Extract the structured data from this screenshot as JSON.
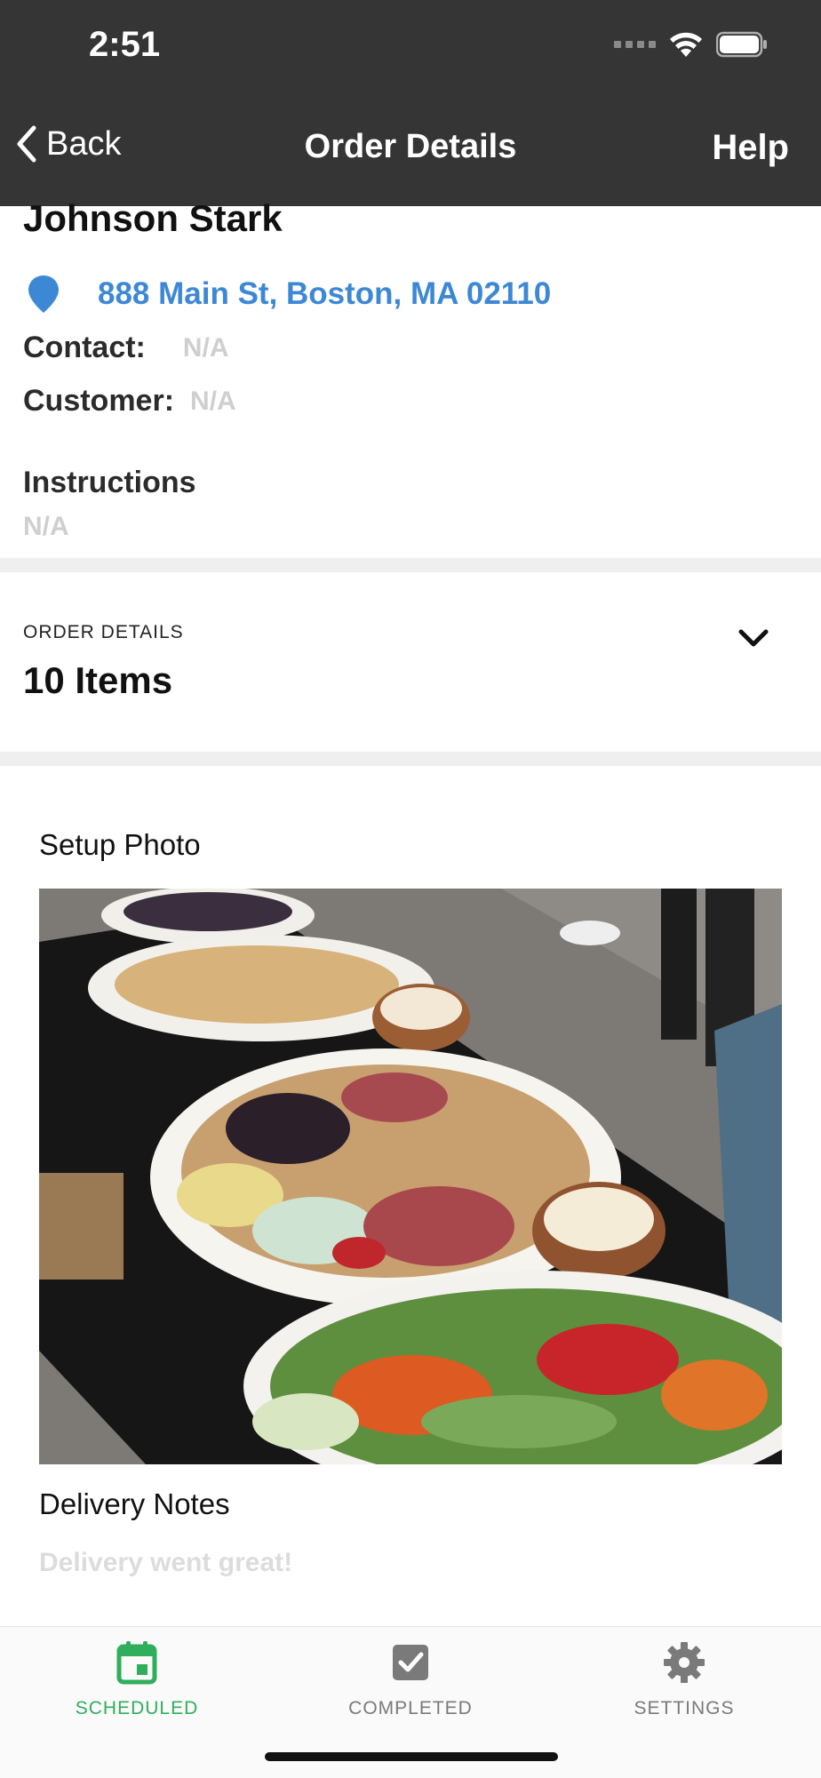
{
  "status_bar": {
    "time": "2:51"
  },
  "nav": {
    "back_label": "Back",
    "title": "Order Details",
    "help_label": "Help"
  },
  "customer": {
    "name": "Johnson Stark",
    "address": "888 Main St, Boston, MA 02110",
    "contact_label": "Contact:",
    "contact_value": "N/A",
    "customer_label": "Customer:",
    "customer_value": "N/A",
    "instructions_title": "Instructions",
    "instructions_value": "N/A"
  },
  "order_details": {
    "section_label": "ORDER DETAILS",
    "item_count": "10 Items"
  },
  "setup_photo": {
    "title": "Setup Photo"
  },
  "delivery_notes": {
    "title": "Delivery Notes",
    "value": "Delivery went great!"
  },
  "tabs": [
    {
      "label": "SCHEDULED",
      "icon": "calendar-icon",
      "active": true
    },
    {
      "label": "COMPLETED",
      "icon": "checkbox-icon",
      "active": false
    },
    {
      "label": "SETTINGS",
      "icon": "gear-icon",
      "active": false
    }
  ],
  "colors": {
    "header_bg": "#353535",
    "link_blue": "#3d88d5",
    "active_green": "#2fae5c",
    "inactive_gray": "#7a7a7a"
  }
}
